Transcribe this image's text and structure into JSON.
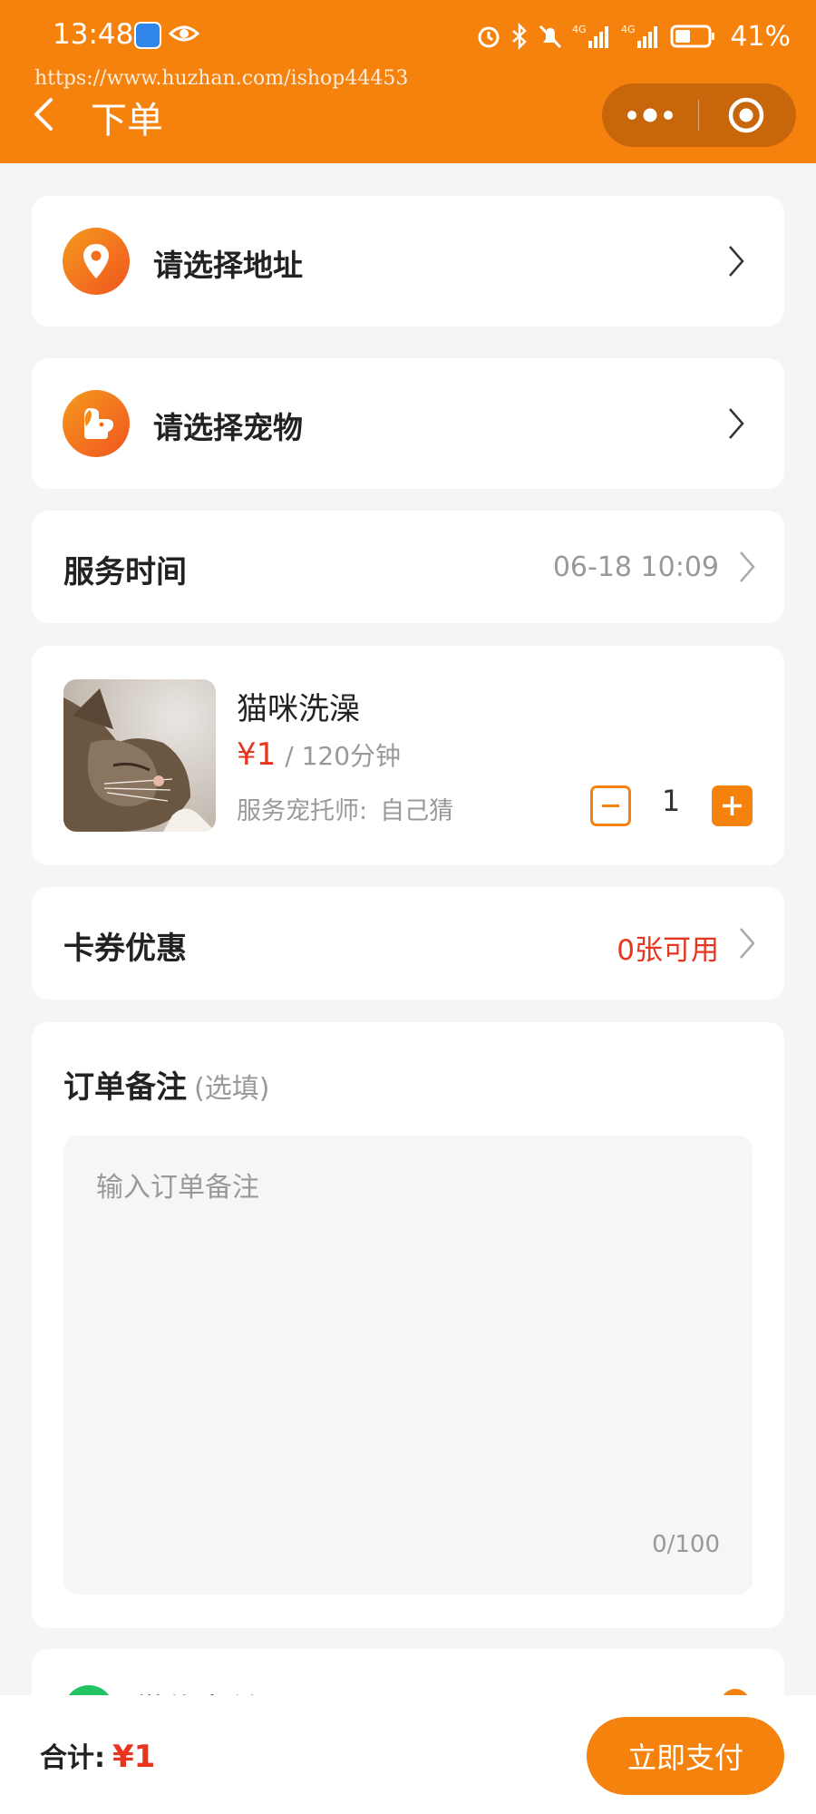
{
  "status_bar": {
    "time": "13:48",
    "battery_percent": "41%",
    "network_1": "4G",
    "network_2": "4G"
  },
  "watermark": "https://www.huzhan.com/ishop44453",
  "nav": {
    "title": "下单"
  },
  "address": {
    "label": "请选择地址",
    "icon": "location-pin-icon"
  },
  "pet": {
    "label": "请选择宠物",
    "icon": "dog-icon"
  },
  "service_time": {
    "label": "服务时间",
    "value": "06-18 10:09"
  },
  "service": {
    "name": "猫咪洗澡",
    "price": "¥1",
    "duration": "/ 120分钟",
    "sitter_label": "服务宠托师:",
    "sitter_name": "自己猜",
    "quantity": "1"
  },
  "coupon": {
    "label": "卡券优惠",
    "value": "0张可用"
  },
  "remark": {
    "title": "订单备注",
    "optional": "(选填)",
    "placeholder": "输入订单备注",
    "count": "0/100"
  },
  "payment": {
    "label": "微信支付"
  },
  "footer": {
    "total_label": "合计:",
    "total_value": "¥1",
    "pay_button": "立即支付"
  },
  "colors": {
    "accent": "#f5820d",
    "price_red": "#e8351f",
    "background": "#f5f5f5",
    "wechat_green": "#23c262"
  }
}
